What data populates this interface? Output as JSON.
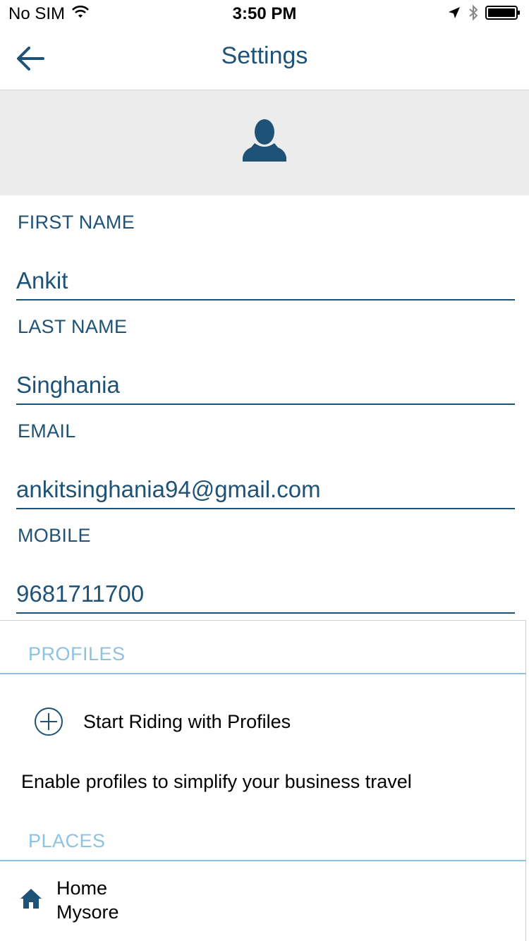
{
  "status_bar": {
    "carrier": "No SIM",
    "time": "3:50 PM",
    "icons": [
      "wifi-icon",
      "location-arrow-icon",
      "bluetooth-icon",
      "battery-icon"
    ]
  },
  "nav": {
    "title": "Settings",
    "back_icon": "back-arrow-icon"
  },
  "avatar": {
    "icon": "user-silhouette-icon"
  },
  "form": {
    "first_name": {
      "label": "FIRST NAME",
      "value": "Ankit"
    },
    "last_name": {
      "label": "LAST NAME",
      "value": "Singhania"
    },
    "email": {
      "label": "EMAIL",
      "value": "ankitsinghania94@gmail.com"
    },
    "mobile": {
      "label": "MOBILE",
      "value": "9681711700"
    }
  },
  "profiles": {
    "header": "PROFILES",
    "start_label": "Start Riding with Profiles",
    "start_icon": "plus-circle-icon",
    "description": "Enable profiles to simplify your business travel"
  },
  "places": {
    "header": "PLACES",
    "items": [
      {
        "icon": "home-icon",
        "name": "Home",
        "address": "Mysore"
      }
    ]
  },
  "colors": {
    "primary": "#1e5276",
    "section_header": "#8cc3e2",
    "avatar_bg": "#ececec"
  }
}
